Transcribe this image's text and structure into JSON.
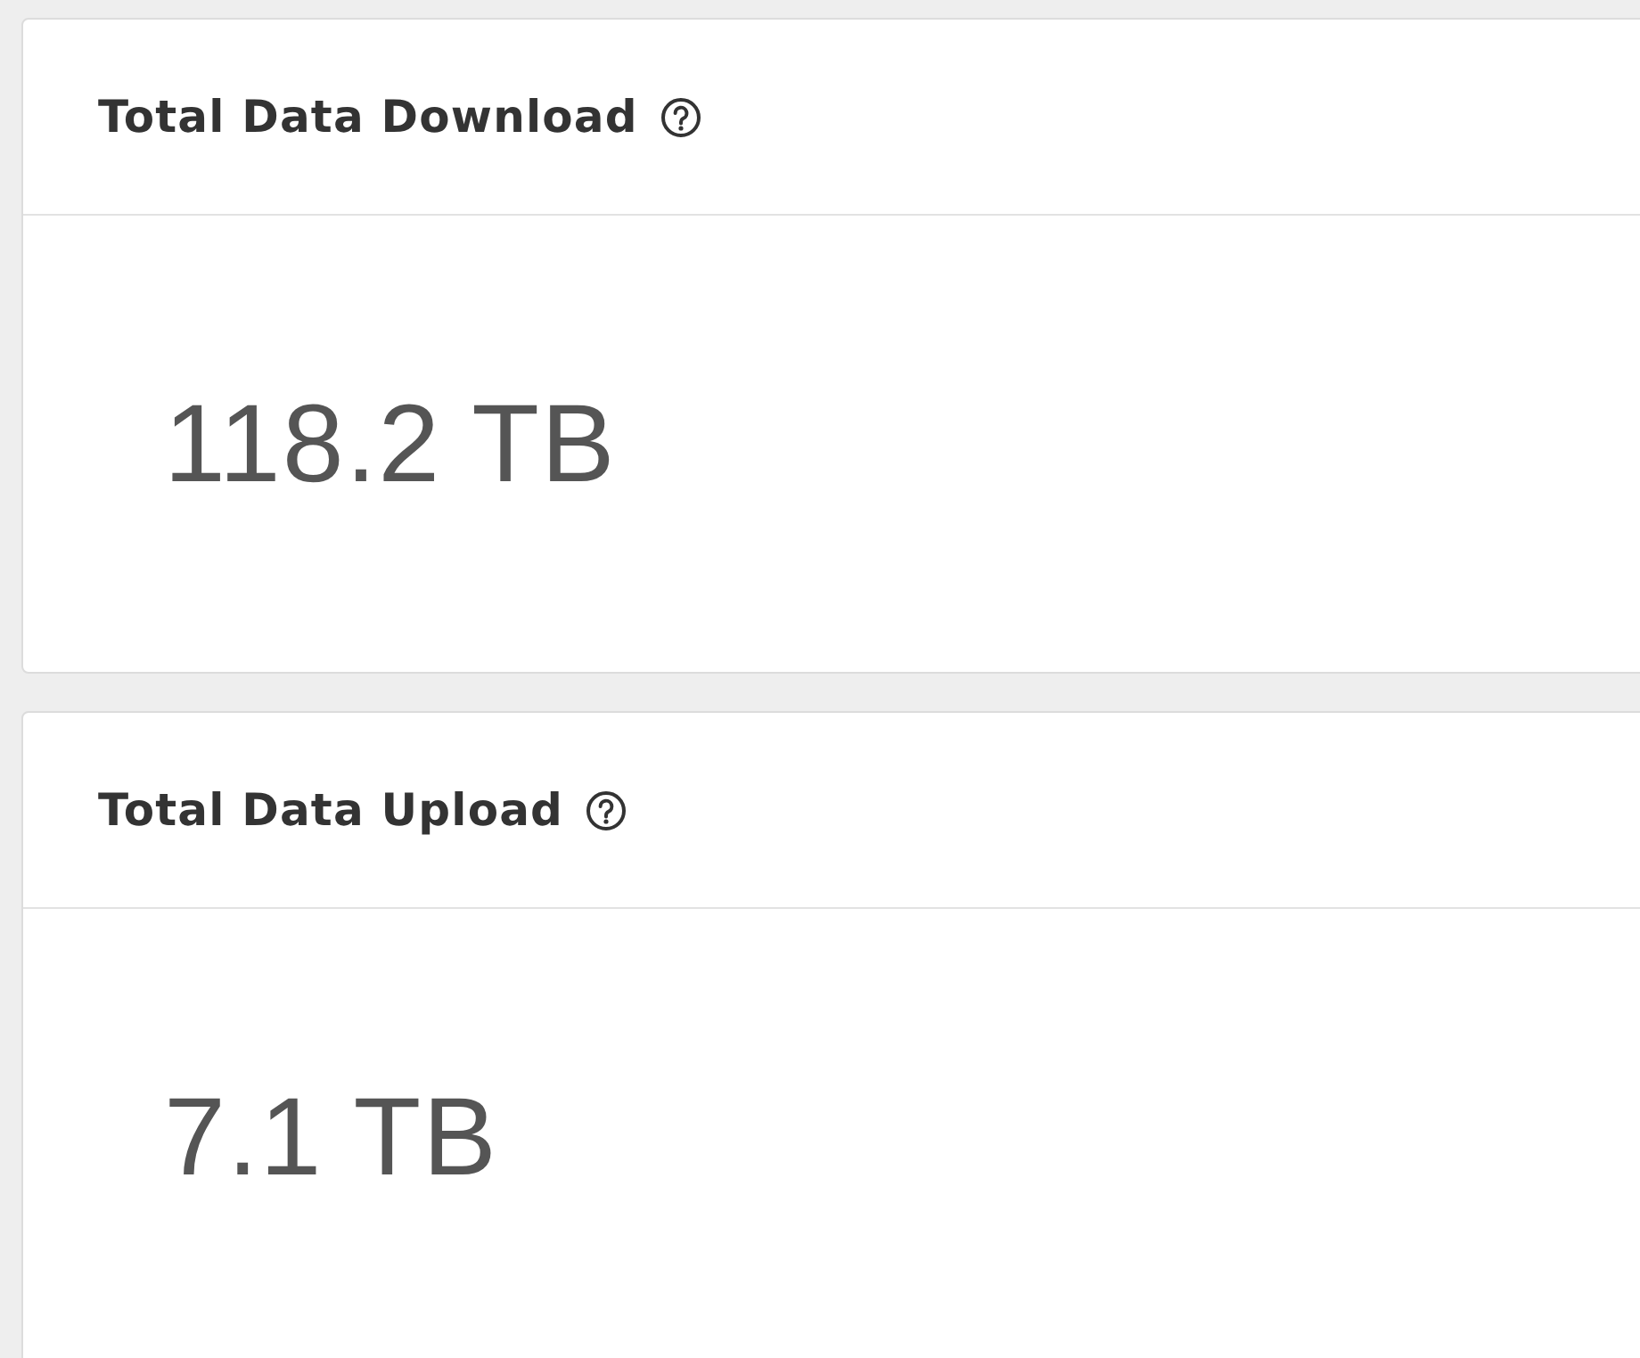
{
  "cards": [
    {
      "title": "Total Data Download",
      "value": "118.2 TB"
    },
    {
      "title": "Total Data Upload",
      "value": "7.1 TB"
    }
  ]
}
